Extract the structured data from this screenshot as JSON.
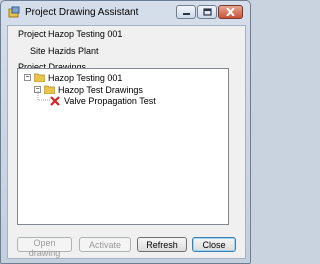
{
  "window": {
    "title": "Project Drawing Assistant"
  },
  "fields": {
    "project_label": "Project",
    "project_value": "Hazop Testing 001",
    "site_label": "Site",
    "site_value": "Hazids Plant",
    "drawings_label": "Project Drawings"
  },
  "tree": {
    "root": {
      "label": "Hazop Testing 001",
      "expander": "−"
    },
    "folder": {
      "label": "Hazop Test Drawings",
      "expander": "−"
    },
    "item": {
      "label": "Valve Propagation Test",
      "icon": "error-x-icon"
    }
  },
  "buttons": {
    "open": "Open drawing",
    "activate": "Activate",
    "refresh": "Refresh",
    "close": "Close"
  },
  "colors": {
    "error_x": "#d42222",
    "folder": "#e8c54a"
  }
}
